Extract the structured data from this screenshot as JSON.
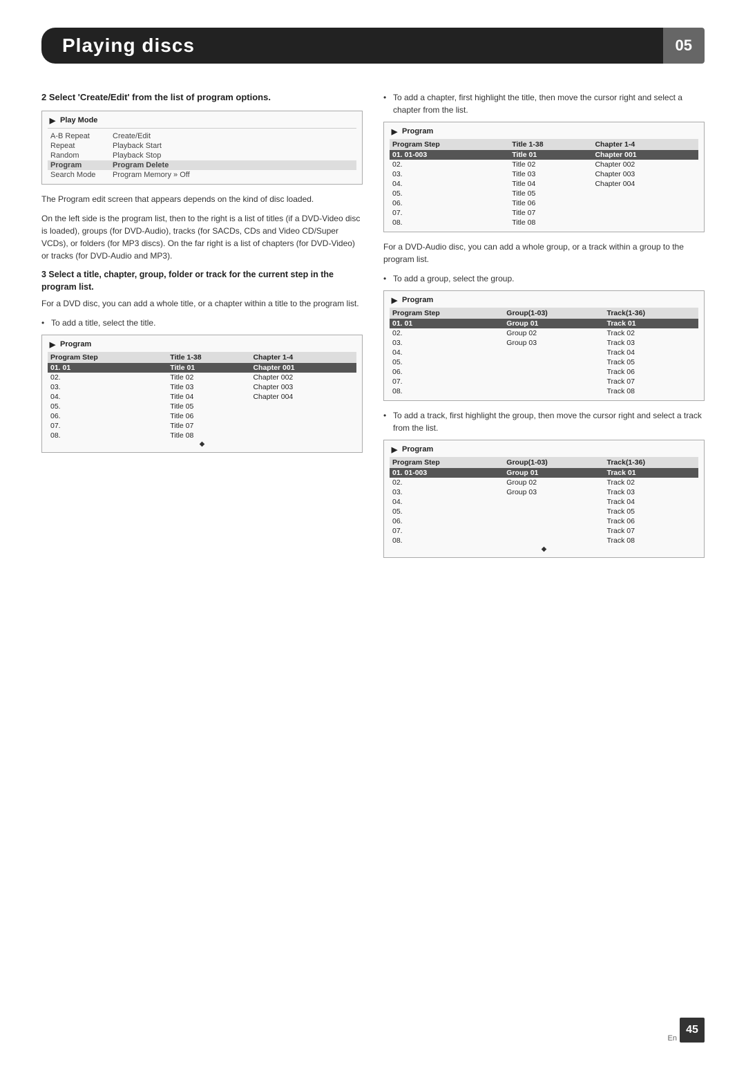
{
  "header": {
    "title": "Playing discs",
    "chapter": "05"
  },
  "page_number": "45",
  "page_lang": "En",
  "step2": {
    "heading": "2   Select 'Create/Edit' from the list of program options.",
    "play_mode_title": "Play Mode",
    "play_mode_rows": [
      {
        "label": "A-B Repeat",
        "value": "Create/Edit",
        "highlight": false,
        "value_highlight": false
      },
      {
        "label": "Repeat",
        "value": "Playback Start",
        "highlight": false,
        "value_highlight": false
      },
      {
        "label": "Random",
        "value": "Playback Stop",
        "highlight": false,
        "value_highlight": false
      },
      {
        "label": "Program",
        "value": "Program Delete",
        "highlight": true,
        "value_highlight": false
      },
      {
        "label": "Search Mode",
        "value": "Program Memory  » Off",
        "highlight": false,
        "value_highlight": false
      }
    ],
    "body1": "The Program edit screen that appears depends on the kind of disc loaded.",
    "body2": "On the left side is the program list, then to the right is a list of titles (if a DVD-Video disc is loaded), groups (for DVD-Audio), tracks (for SACDs, CDs and Video CD/Super VCDs), or folders (for MP3 discs). On the far right is a list of chapters (for DVD-Video) or tracks (for DVD-Audio and MP3)."
  },
  "step3": {
    "heading": "3   Select a title, chapter, group, folder or track for the current step in the program list.",
    "body1": "For a DVD disc, you can add a whole title, or a chapter within a title to the program list.",
    "bullet1": "To add a title, select the title.",
    "program_table1": {
      "title": "Program",
      "columns": [
        "Program Step",
        "Title 1-38",
        "Chapter 1-4"
      ],
      "rows": [
        {
          "step": "01. 01",
          "col2": "Title 01",
          "col3": "Chapter 001",
          "highlight": true
        },
        {
          "step": "02.",
          "col2": "Title 02",
          "col3": "Chapter 002",
          "highlight": false
        },
        {
          "step": "03.",
          "col2": "Title 03",
          "col3": "Chapter 003",
          "highlight": false
        },
        {
          "step": "04.",
          "col2": "Title 04",
          "col3": "Chapter 004",
          "highlight": false
        },
        {
          "step": "05.",
          "col2": "Title 05",
          "col3": "",
          "highlight": false
        },
        {
          "step": "06.",
          "col2": "Title 06",
          "col3": "",
          "highlight": false
        },
        {
          "step": "07.",
          "col2": "Title 07",
          "col3": "",
          "highlight": false
        },
        {
          "step": "08.",
          "col2": "Title 08",
          "col3": "",
          "highlight": false
        }
      ]
    }
  },
  "right_col": {
    "bullet_chapter": "To add a chapter, first highlight the title, then move the cursor right and select a chapter from the list.",
    "program_table2": {
      "title": "Program",
      "columns": [
        "Program Step",
        "Title 1-38",
        "Chapter 1-4"
      ],
      "rows": [
        {
          "step": "01. 01-003",
          "col2": "Title 01",
          "col3": "Chapter 001",
          "highlight": true
        },
        {
          "step": "02.",
          "col2": "Title 02",
          "col3": "Chapter 002",
          "highlight": false
        },
        {
          "step": "03.",
          "col2": "Title 03",
          "col3": "Chapter 003",
          "highlight": false
        },
        {
          "step": "04.",
          "col2": "Title 04",
          "col3": "Chapter 004",
          "highlight": false
        },
        {
          "step": "05.",
          "col2": "Title 05",
          "col3": "",
          "highlight": false
        },
        {
          "step": "06.",
          "col2": "Title 06",
          "col3": "",
          "highlight": false
        },
        {
          "step": "07.",
          "col2": "Title 07",
          "col3": "",
          "highlight": false
        },
        {
          "step": "08.",
          "col2": "Title 08",
          "col3": "",
          "highlight": false
        }
      ]
    },
    "body_dvd_audio": "For a DVD-Audio disc, you can add a whole group, or a track within a group to the program list.",
    "bullet_group": "To add a group, select the group.",
    "program_table3": {
      "title": "Program",
      "columns": [
        "Program Step",
        "Group(1-03)",
        "Track(1-36)"
      ],
      "rows": [
        {
          "step": "01. 01",
          "col2": "Group 01",
          "col3": "Track 01",
          "highlight": true
        },
        {
          "step": "02.",
          "col2": "Group 02",
          "col3": "Track 02",
          "highlight": false
        },
        {
          "step": "03.",
          "col2": "Group 03",
          "col3": "Track 03",
          "highlight": false
        },
        {
          "step": "04.",
          "col2": "",
          "col3": "Track 04",
          "highlight": false
        },
        {
          "step": "05.",
          "col2": "",
          "col3": "Track 05",
          "highlight": false
        },
        {
          "step": "06.",
          "col2": "",
          "col3": "Track 06",
          "highlight": false
        },
        {
          "step": "07.",
          "col2": "",
          "col3": "Track 07",
          "highlight": false
        },
        {
          "step": "08.",
          "col2": "",
          "col3": "Track 08",
          "highlight": false
        }
      ]
    },
    "bullet_track": "To add a track, first highlight the group, then move the cursor right and select a track from the list.",
    "program_table4": {
      "title": "Program",
      "columns": [
        "Program Step",
        "Group(1-03)",
        "Track(1-36)"
      ],
      "rows": [
        {
          "step": "01. 01-003",
          "col2": "Group 01",
          "col3": "Track 01",
          "highlight": true
        },
        {
          "step": "02.",
          "col2": "Group 02",
          "col3": "Track 02",
          "highlight": false
        },
        {
          "step": "03.",
          "col2": "Group 03",
          "col3": "Track 03",
          "highlight": false
        },
        {
          "step": "04.",
          "col2": "",
          "col3": "Track 04",
          "highlight": false
        },
        {
          "step": "05.",
          "col2": "",
          "col3": "Track 05",
          "highlight": false
        },
        {
          "step": "06.",
          "col2": "",
          "col3": "Track 06",
          "highlight": false
        },
        {
          "step": "07.",
          "col2": "",
          "col3": "Track 07",
          "highlight": false
        },
        {
          "step": "08.",
          "col2": "",
          "col3": "Track 08",
          "highlight": false
        }
      ]
    }
  }
}
